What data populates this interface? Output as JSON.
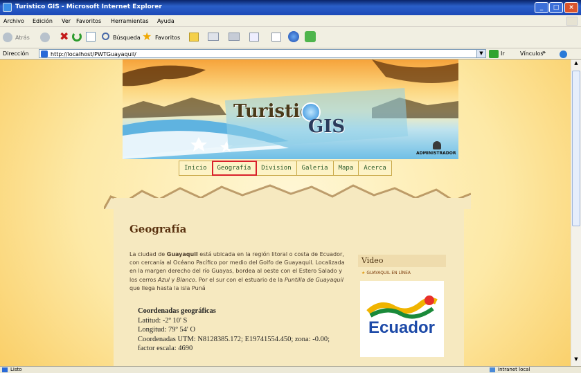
{
  "window": {
    "title": "Turistico GIS - Microsoft Internet Explorer"
  },
  "menu": [
    "Archivo",
    "Edición",
    "Ver",
    "Favoritos",
    "Herramientas",
    "Ayuda"
  ],
  "toolbar": {
    "back": "Atrás",
    "search": "Búsqueda",
    "favorites": "Favoritos"
  },
  "address": {
    "label": "Dirección",
    "url": "http://localhost/PWTGuayaquil/",
    "go": "Ir",
    "links": "Vínculos"
  },
  "banner": {
    "logo_top": "Turistic",
    "logo_bottom": "GIS",
    "admin": "ADMINISTRADOR"
  },
  "nav": {
    "items": [
      "Inicio",
      "Geografía",
      "Division",
      "Galeria",
      "Mapa",
      "Acerca"
    ],
    "active": "Geografía"
  },
  "page": {
    "title": "Geografía",
    "p1": "La ciudad de ",
    "p_city": "Guayaquil",
    "p2": " está ubicada en la región litoral o costa de Ecuador, con cercanía al Océano Pacífico por medio del Golfo de Guayaquil. Localizada en la margen derecho del río Guayas, bordea al oeste con el Estero Salado y los cerros ",
    "p_azul": "Azul",
    "p3": " y ",
    "p_blanco": "Blanco",
    "p4": ". Por el sur con el estuario de la ",
    "p_puntilla": "Puntilla de Guayaquil",
    "p5": " que llega hasta la isla Puná",
    "coords_title": "Coordenadas geográficas",
    "lat": "Latitud: -2º 10' S",
    "lon": "Longitud: 79º 54' O",
    "utm": "Coordenadas UTM: N8128385.172; E19741554.450; zona: -0.00; factor escala: 4690"
  },
  "video": {
    "title": "Video",
    "link": "GUAYAQUIL EN LÍNEA",
    "brand": "Ecuador"
  },
  "status": {
    "left": "Listo",
    "right": "Intranet local"
  }
}
